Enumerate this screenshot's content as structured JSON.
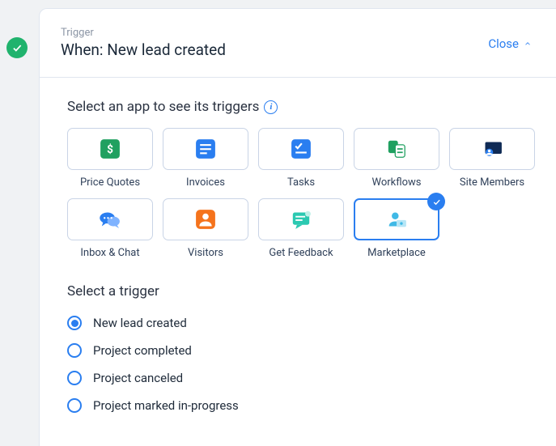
{
  "header": {
    "eyebrow": "Trigger",
    "title": "When: New lead created",
    "close_label": "Close"
  },
  "apps": {
    "section_label": "Select an app to see its triggers",
    "items": [
      {
        "label": "Price Quotes",
        "icon": "price-quotes",
        "selected": false
      },
      {
        "label": "Invoices",
        "icon": "invoices",
        "selected": false
      },
      {
        "label": "Tasks",
        "icon": "tasks",
        "selected": false
      },
      {
        "label": "Workflows",
        "icon": "workflows",
        "selected": false
      },
      {
        "label": "Site Members",
        "icon": "site-members",
        "selected": false
      },
      {
        "label": "Inbox & Chat",
        "icon": "inbox-chat",
        "selected": false
      },
      {
        "label": "Visitors",
        "icon": "visitors",
        "selected": false
      },
      {
        "label": "Get Feedback",
        "icon": "get-feedback",
        "selected": false
      },
      {
        "label": "Marketplace",
        "icon": "marketplace",
        "selected": true
      }
    ]
  },
  "triggers": {
    "section_label": "Select a trigger",
    "options": [
      {
        "label": "New lead created",
        "selected": true
      },
      {
        "label": "Project completed",
        "selected": false
      },
      {
        "label": "Project canceled",
        "selected": false
      },
      {
        "label": "Project marked in-progress",
        "selected": false
      }
    ]
  },
  "colors": {
    "blue": "#2a7ef0",
    "green": "#20b36d"
  }
}
